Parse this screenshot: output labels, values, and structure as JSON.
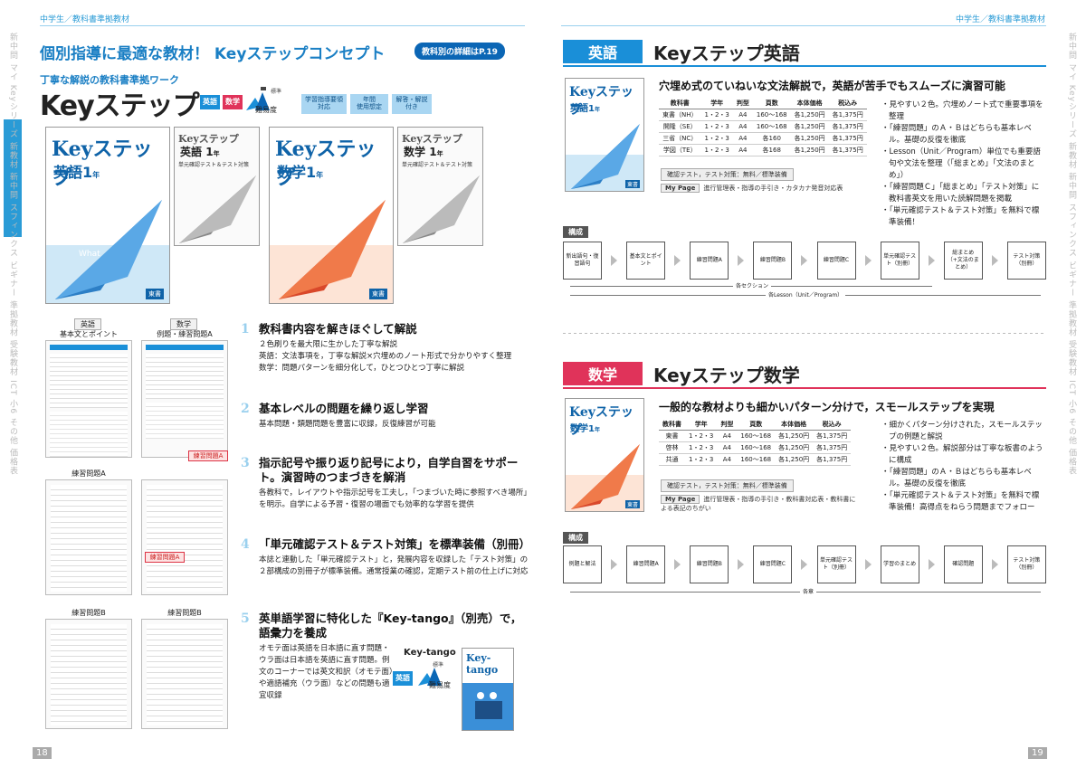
{
  "left": {
    "breadcrumb": "中学生／教科書準拠教材",
    "headline": "個別指導に最適な教材！ Keyステップコンセプト",
    "detail_badge": "教科別の詳細はP.19",
    "subtitle": "丁寧な解説の教科書準拠ワーク",
    "product_title": "Keyステップ",
    "subject_tags": [
      "英語",
      "数学"
    ],
    "level_label": "難易度",
    "level_mark": "標準",
    "pill_level_mark": "標準",
    "info_boxes": [
      {
        "line1": "学習指導要領",
        "line2": "対応"
      },
      {
        "line1": "年間",
        "line2": "使用想定"
      },
      {
        "line1": "解答・解説",
        "line2": "付き"
      }
    ],
    "covers": [
      {
        "logo": "Keyステップ",
        "subject": "英語",
        "grade": "1",
        "suffix": "年",
        "publisher": "東書"
      },
      {
        "logo": "Keyステップ",
        "subject": "英語",
        "grade": "1",
        "suffix": "年",
        "note": "単元確認テスト＆テスト対策"
      },
      {
        "logo": "Keyステップ",
        "subject": "数学",
        "grade": "1",
        "suffix": "年",
        "publisher": "東書"
      },
      {
        "logo": "Keyステップ",
        "subject": "数学",
        "grade": "1",
        "suffix": "年",
        "note": "単元確認テスト＆テスト対策"
      }
    ],
    "thumbs": {
      "english_title": "英語",
      "english_sub": "基本文とポイント",
      "math_title": "数学",
      "math_sub": "例題・練習問題A",
      "red_label_1": "練習問題A",
      "red_label_2": "練習問題A",
      "label_a": "練習問題A",
      "label_b1": "練習問題B",
      "label_b2": "練習問題B"
    },
    "points": [
      {
        "num": "1",
        "head": "教科書内容を解きほぐして解説",
        "body": [
          "２色刷りを最大限に生かした丁寧な解説",
          "英語：文法事項を，丁寧な解説×穴埋めのノート形式で分かりやすく整理",
          "数学：問題パターンを細分化して，ひとつひとつ丁寧に解説"
        ]
      },
      {
        "num": "2",
        "head": "基本レベルの問題を繰り返し学習",
        "body": [
          "基本問題・類題問題を豊富に収録，反復練習が可能"
        ]
      },
      {
        "num": "3",
        "head": "指示記号や振り返り記号により，自学自習をサポート。演習時のつまづきを解消",
        "body": [
          "各教科で，レイアウトや指示記号を工夫し，「つまづいた時に参照すべき場所」を明示。自学による予習・復習の場面でも効率的な学習を提供"
        ]
      },
      {
        "num": "4",
        "head": "「単元確認テスト＆テスト対策」を標準装備（別冊）",
        "body": [
          "本誌と連動した「単元確認テスト」と，発展内容を収録した「テスト対策」の２部構成の別冊子が標準装備。通常授業の確認，定期テスト前の仕上げに対応"
        ]
      },
      {
        "num": "5",
        "head": "英単語学習に特化した『Key-tango』（別売）で，語彙力を養成",
        "body": [
          "オモテ面は英語を日本語に直す問題・ウラ面は日本語を英語に直す問題。例文のコーナーでは英文和訳（オモテ面）や適語補充（ウラ面）などの問題も適宜収録"
        ]
      }
    ],
    "keytango": {
      "label": "Key-tango",
      "tag": "英語",
      "cover_logo": "Key-tango",
      "cover_subject": "英語"
    },
    "page_num": "18"
  },
  "right": {
    "breadcrumb": "中学生／教科書準拠教材",
    "english": {
      "label": "英語",
      "title": "Keyステップ英語",
      "lead": "穴埋め式のていねいな文法解説で，英語が苦手でもスムーズに演習可能",
      "cover": {
        "logo": "Keyステップ",
        "subject": "英語",
        "grade": "1",
        "suffix": "年",
        "publisher": "東書"
      },
      "table_head": [
        "教科書",
        "学年",
        "判型",
        "頁数",
        "本体価格",
        "税込み"
      ],
      "table_rows": [
        [
          "東書（NH）",
          "1・2・3",
          "A4",
          "160～168",
          "各1,250円",
          "各1,375円"
        ],
        [
          "開隆（SE）",
          "1・2・3",
          "A4",
          "160～168",
          "各1,250円",
          "各1,375円"
        ],
        [
          "三省（NC）",
          "1・2・3",
          "A4",
          "各160",
          "各1,250円",
          "各1,375円"
        ],
        [
          "学図（TE）",
          "1・2・3",
          "A4",
          "各168",
          "各1,250円",
          "各1,375円"
        ]
      ],
      "pill": "確認テスト，テスト対策：無料／標準装備",
      "mypage_label": "My Page",
      "mypage_text": "進行管理表・指導の手引き・カタカナ発音対応表",
      "bullets": [
        "・見やすい２色。穴埋めノート式で重要事項を整理",
        "・「練習問題」のＡ・Ｂはどちらも基本レベル。基礎の反復を徹底",
        "・Lesson（Unit／Program）単位でも重要語句や文法を整理（「総まとめ」「文法のまとめ」）",
        "・「練習問題Ｃ」「総まとめ」「テスト対策」に教科書英文を用いた読解問題を掲載",
        "・「単元確認テスト＆テスト対策」を無料で標準装備！"
      ],
      "kosei": "構成",
      "flow": [
        "新出語句・復習語句",
        "基本文とポイント",
        "練習問題A",
        "練習問題B",
        "練習問題C",
        "単元確認テスト（別冊）",
        "総まとめ（+文法のまとめ）",
        "テスト対策（別冊）"
      ],
      "span1": "各セクション",
      "span2": "各Lesson（Unit／Program）"
    },
    "math": {
      "label": "数学",
      "title": "Keyステップ数学",
      "lead": "一般的な教材よりも細かいパターン分けで，スモールステップを実現",
      "cover": {
        "logo": "Keyステップ",
        "subject": "数学",
        "grade": "1",
        "suffix": "年",
        "publisher": "東書"
      },
      "table_head": [
        "教科書",
        "学年",
        "判型",
        "頁数",
        "本体価格",
        "税込み"
      ],
      "table_rows": [
        [
          "東書",
          "1・2・3",
          "A4",
          "160～168",
          "各1,250円",
          "各1,375円"
        ],
        [
          "啓林",
          "1・2・3",
          "A4",
          "160～168",
          "各1,250円",
          "各1,375円"
        ],
        [
          "共通",
          "1・2・3",
          "A4",
          "160～168",
          "各1,250円",
          "各1,375円"
        ]
      ],
      "pill": "確認テスト，テスト対策：無料／標準装備",
      "mypage_label": "My Page",
      "mypage_text": "進行管理表・指導の手引き・教科書対応表・教科書による表記のちがい",
      "bullets": [
        "・細かくパターン分けされた，スモールステップの例題と解説",
        "・見やすい２色。解説部分は丁寧な板書のように構成",
        "・「練習問題」のＡ・Ｂはどちらも基本レベル。基礎の反復を徹底",
        "・「単元確認テスト＆テスト対策」を無料で標準装備！高得点をねらう問題までフォロー"
      ],
      "kosei": "構成",
      "flow": [
        "例題と解法",
        "練習問題A",
        "練習問題B",
        "練習問題C",
        "単元確認テスト（別冊）",
        "学習のまとめ",
        "確認問題",
        "テスト対策（別冊）"
      ],
      "span1": "各章"
    },
    "page_num": "19"
  },
  "sidebars": {
    "left": "新中問 マイ Keyシリーズ 新教材 新中問 スフィンクス ビギナー 準拠教材 受験教材 ICT 小6 その他 価格表",
    "right": "新中問 マイ Keyシリーズ 新教材 新中問 スフィンクス ビギナー 準拠教材 受験教材 ICT 小6 その他 価格表"
  },
  "colors": {
    "english": "#1a8fd8",
    "math": "#e0335a",
    "accent": "#1a7fc4",
    "red": "#e04030"
  }
}
